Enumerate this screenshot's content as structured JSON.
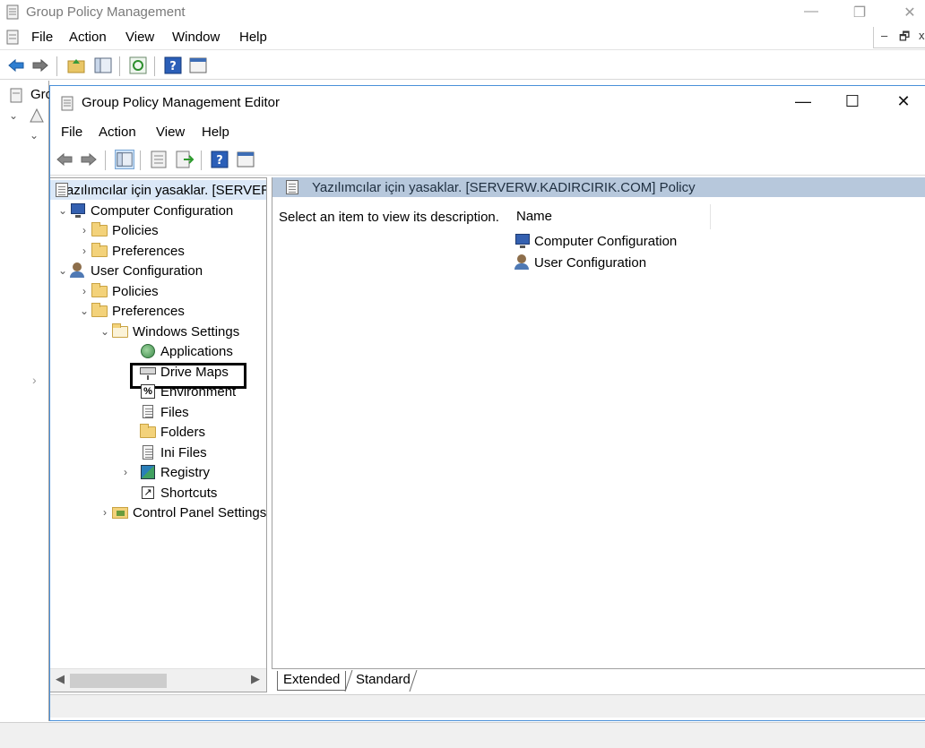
{
  "outer": {
    "title": "Group Policy Management",
    "menu": [
      "File",
      "Action",
      "View",
      "Window",
      "Help"
    ],
    "tree_partial": "Gro",
    "win_buttons": {
      "minimize": "—",
      "restore": "❐",
      "close": "✕"
    },
    "mdi_buttons": {
      "minimize": "–",
      "restore": "🗗",
      "close": "x"
    }
  },
  "editor": {
    "title": "Group Policy Management Editor",
    "menu": [
      "File",
      "Action",
      "View",
      "Help"
    ],
    "win_buttons": {
      "minimize": "—",
      "maximize": "☐",
      "close": "✕"
    },
    "tree": {
      "root": "Yazılımcılar için yasaklar. [SERVERW.KADIRCIRIK.COM] Policy",
      "computer_configuration": "Computer Configuration",
      "cc_policies": "Policies",
      "cc_preferences": "Preferences",
      "user_configuration": "User Configuration",
      "uc_policies": "Policies",
      "uc_preferences": "Preferences",
      "windows_settings": "Windows Settings",
      "applications": "Applications",
      "drive_maps": "Drive Maps",
      "environment": "Environment",
      "files": "Files",
      "folders": "Folders",
      "ini_files": "Ini Files",
      "registry": "Registry",
      "shortcuts": "Shortcuts",
      "control_panel_settings": "Control Panel Settings"
    },
    "right": {
      "header": "Yazılımcılar için yasaklar. [SERVERW.KADIRCIRIK.COM] Policy",
      "description": "Select an item to view its description.",
      "column_name": "Name",
      "items": [
        "Computer Configuration",
        "User Configuration"
      ]
    },
    "tabs": {
      "extended": "Extended",
      "standard": "Standard"
    }
  },
  "colors": {
    "header_band": "#b7c8dc",
    "selection": "#dbe8f7",
    "window_border": "#4a90d9"
  }
}
